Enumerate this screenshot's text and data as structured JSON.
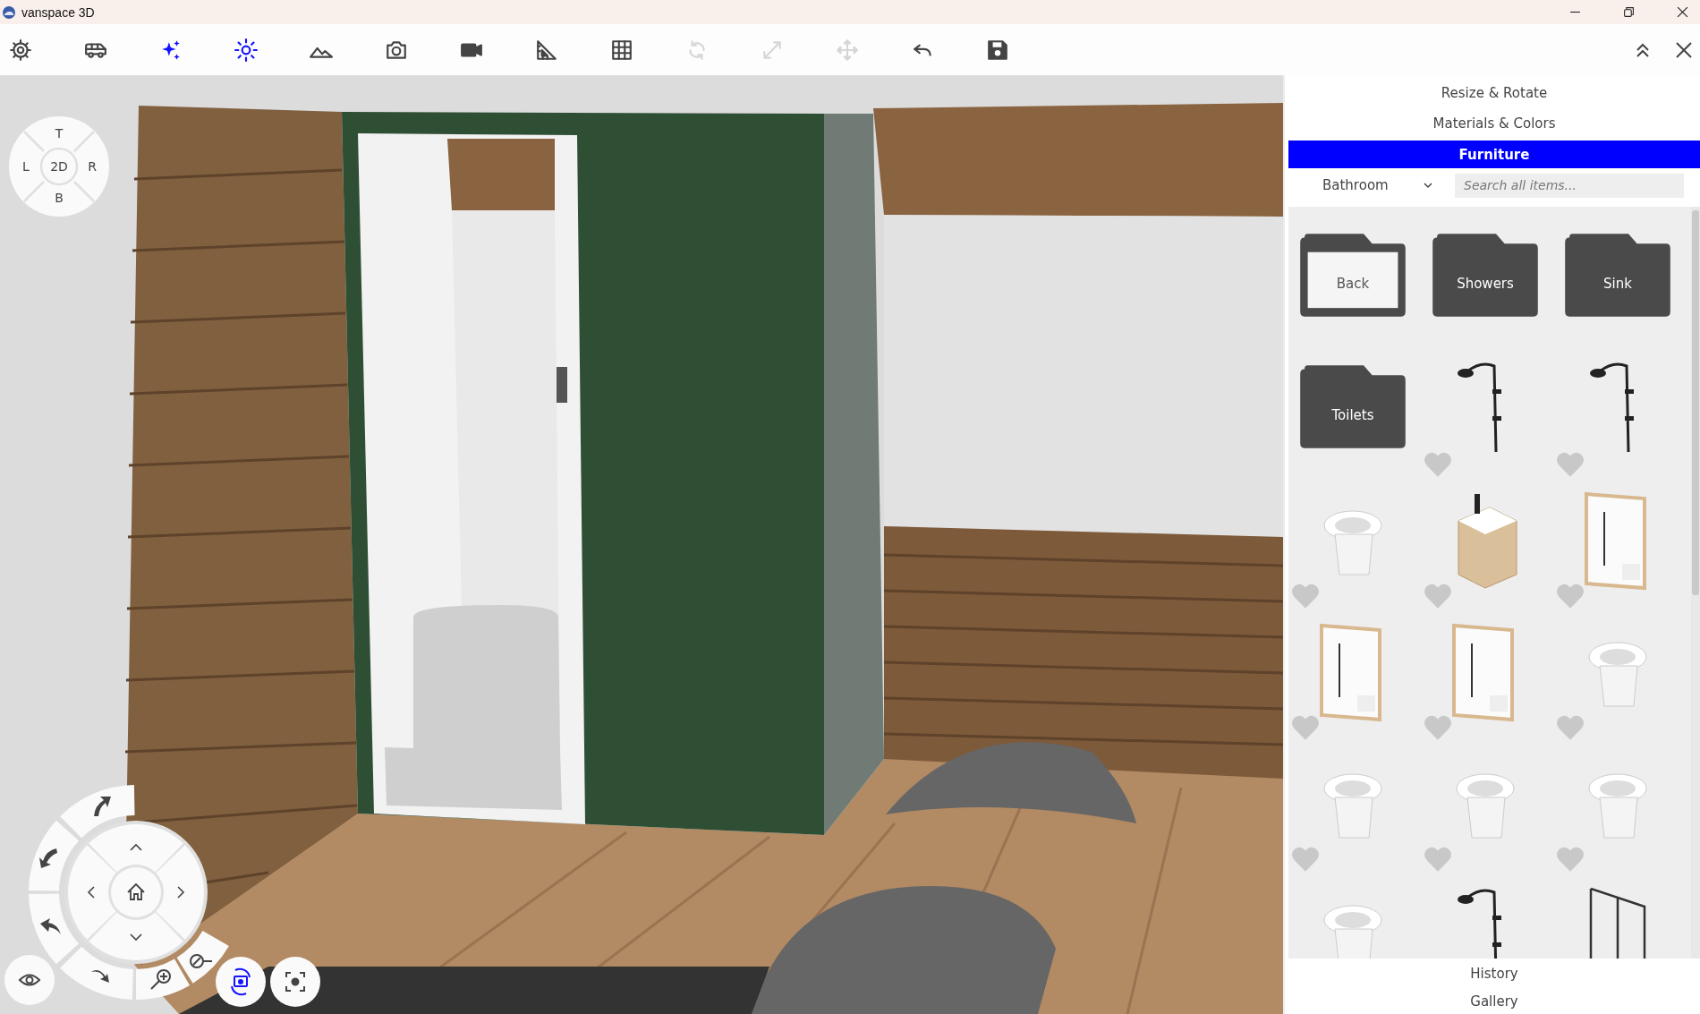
{
  "window": {
    "title": "vanspace 3D"
  },
  "toolbar": {
    "tools": [
      {
        "active": false,
        "disabled": false
      },
      {
        "active": false,
        "disabled": false
      },
      {
        "active": true,
        "disabled": false
      },
      {
        "active": true,
        "disabled": false
      },
      {
        "active": false,
        "disabled": false
      },
      {
        "active": false,
        "disabled": false
      },
      {
        "active": false,
        "disabled": false
      },
      {
        "active": false,
        "disabled": false
      },
      {
        "active": false,
        "disabled": false
      },
      {
        "active": false,
        "disabled": true
      },
      {
        "active": false,
        "disabled": true
      },
      {
        "active": false,
        "disabled": true
      },
      {
        "active": false,
        "disabled": false
      },
      {
        "active": false,
        "disabled": false
      }
    ]
  },
  "compass": {
    "top": "T",
    "left": "L",
    "center": "2D",
    "right": "R",
    "bottom": "B"
  },
  "panel": {
    "tabs": [
      {
        "label": "Resize & Rotate",
        "selected": false
      },
      {
        "label": "Materials & Colors",
        "selected": false
      },
      {
        "label": "Furniture",
        "selected": true
      }
    ],
    "category": "Bathroom",
    "search": {
      "placeholder": "Search all items..."
    },
    "tiles": [
      {
        "kind": "back",
        "label": "Back"
      },
      {
        "kind": "folder",
        "label": "Showers"
      },
      {
        "kind": "folder",
        "label": "Sink"
      },
      {
        "kind": "folder",
        "label": "Toilets"
      },
      {
        "kind": "item",
        "favorite": false
      },
      {
        "kind": "item",
        "favorite": false
      },
      {
        "kind": "item",
        "favorite": false
      },
      {
        "kind": "item",
        "favorite": false
      },
      {
        "kind": "item",
        "favorite": false
      },
      {
        "kind": "item",
        "favorite": false
      },
      {
        "kind": "item",
        "favorite": false
      },
      {
        "kind": "item",
        "favorite": false
      },
      {
        "kind": "item",
        "favorite": false
      },
      {
        "kind": "item",
        "favorite": false
      },
      {
        "kind": "item",
        "favorite": false
      },
      {
        "kind": "item"
      },
      {
        "kind": "item"
      },
      {
        "kind": "item"
      }
    ],
    "bottom_tabs": [
      {
        "label": "History",
        "selected": false
      },
      {
        "label": "Gallery",
        "selected": false
      }
    ]
  }
}
